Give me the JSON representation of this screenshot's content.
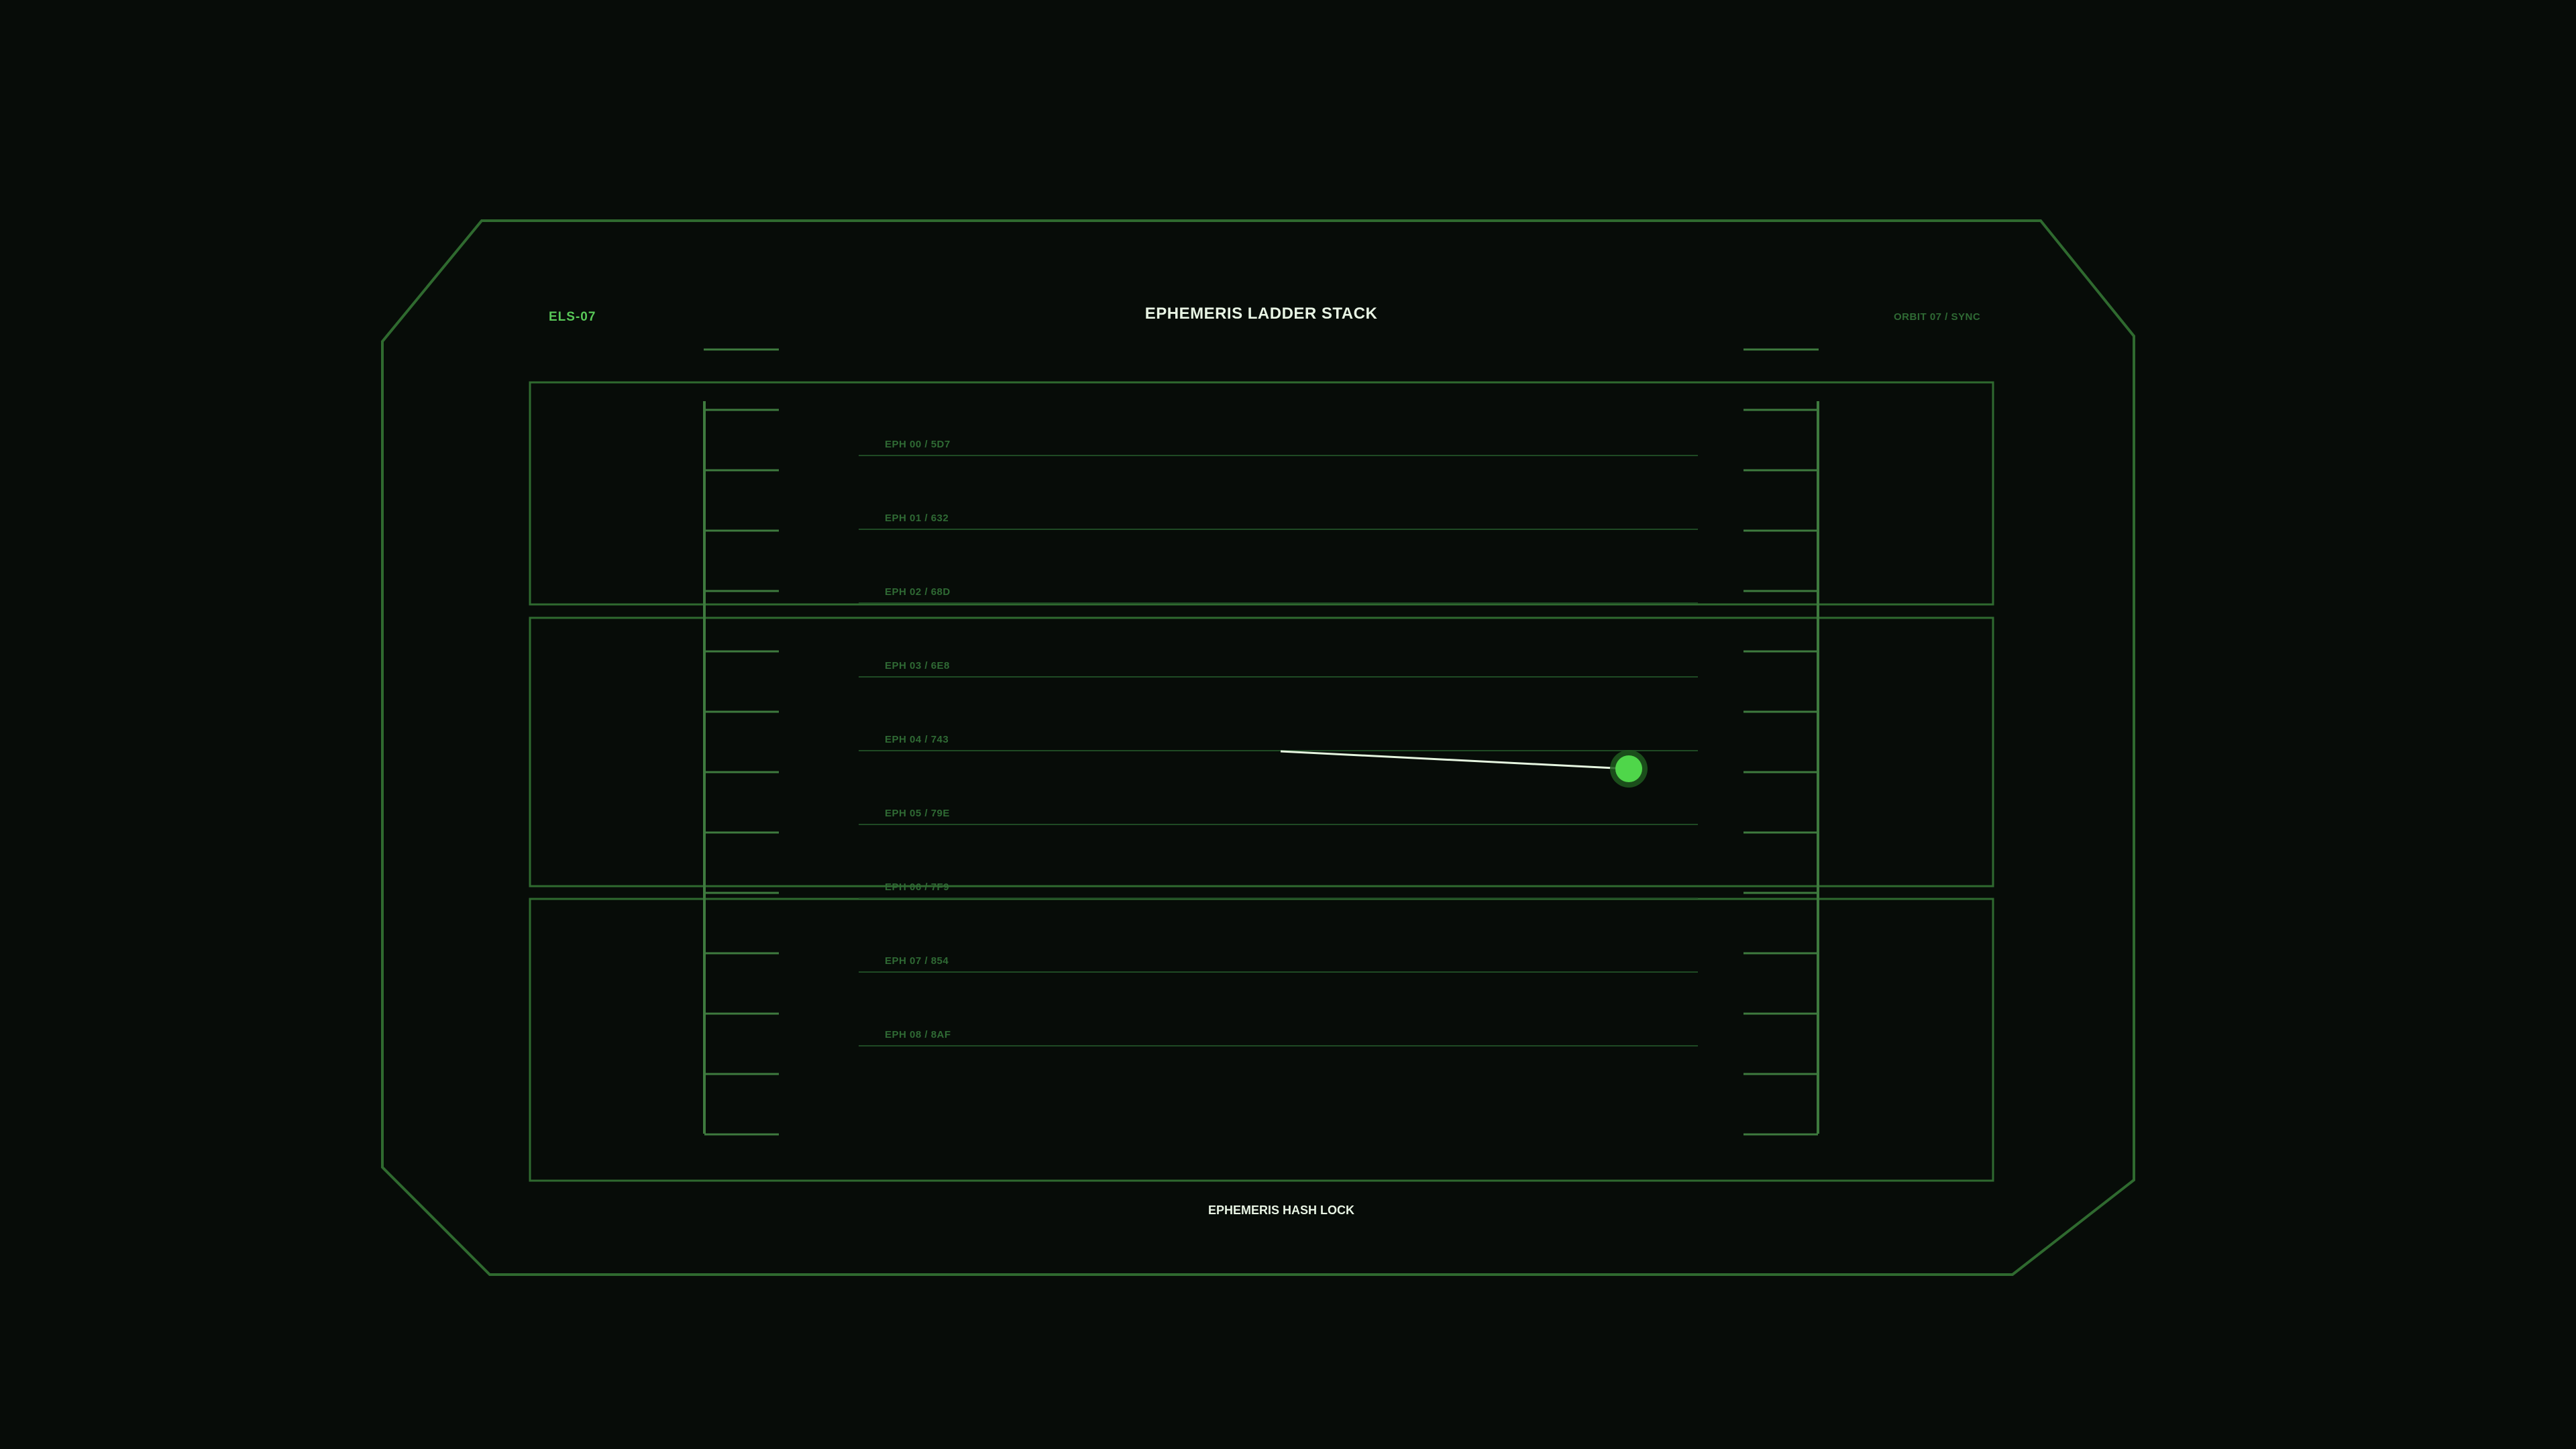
{
  "header": {
    "code": "ELS-07",
    "title": "EPHEMERIS LADDER STACK",
    "status": "ORBIT 07 / SYNC"
  },
  "footer": {
    "label": "EPHEMERIS HASH LOCK"
  },
  "ephemeris_rows": [
    {
      "label": "EPH 00 / 5D7"
    },
    {
      "label": "EPH 01 / 632"
    },
    {
      "label": "EPH 02 / 68D"
    },
    {
      "label": "EPH 03 / 6E8"
    },
    {
      "label": "EPH 04 / 743"
    },
    {
      "label": "EPH 05 / 79E"
    },
    {
      "label": "EPH 06 / 7F9"
    },
    {
      "label": "EPH 07 / 854"
    },
    {
      "label": "EPH 08 / 8AF"
    }
  ],
  "ladder": {
    "tick_count": 13
  },
  "colors": {
    "background": "#070c08",
    "frame": "#2f6a2f",
    "rail": "#3e7a3e",
    "row_line": "#1f4a24",
    "row_label": "#2f6a34",
    "code_text": "#58c858",
    "title_text": "#e8f4e4",
    "status_text": "#2f6a34",
    "marker_fill": "#4fd64a",
    "marker_glow": "#1f5a1f",
    "needle": "#e6f6e0"
  }
}
